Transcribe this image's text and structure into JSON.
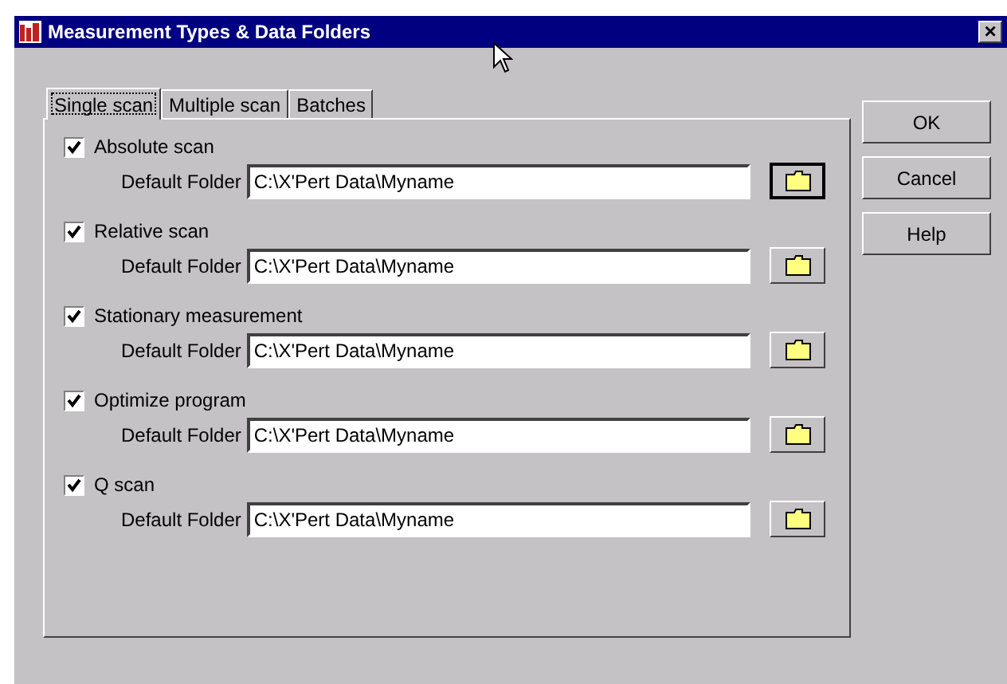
{
  "window": {
    "title": "Measurement Types & Data Folders",
    "close_label": "×"
  },
  "tabs": [
    {
      "label": "Single scan",
      "selected": true
    },
    {
      "label": "Multiple scan",
      "selected": false
    },
    {
      "label": "Batches",
      "selected": false
    }
  ],
  "measurements": [
    {
      "label": "Absolute scan",
      "checked": true,
      "folder_label": "Default Folder",
      "folder": "C:\\X'Pert Data\\Myname",
      "browse_focused": true
    },
    {
      "label": "Relative scan",
      "checked": true,
      "folder_label": "Default Folder",
      "folder": "C:\\X'Pert Data\\Myname",
      "browse_focused": false
    },
    {
      "label": "Stationary measurement",
      "checked": true,
      "folder_label": "Default Folder",
      "folder": "C:\\X'Pert Data\\Myname",
      "browse_focused": false
    },
    {
      "label": "Optimize program",
      "checked": true,
      "folder_label": "Default Folder",
      "folder": "C:\\X'Pert Data\\Myname",
      "browse_focused": false
    },
    {
      "label": "Q scan",
      "checked": true,
      "folder_label": "Default Folder",
      "folder": "C:\\X'Pert Data\\Myname",
      "browse_focused": false
    }
  ],
  "buttons": [
    "OK",
    "Cancel",
    "Help"
  ]
}
